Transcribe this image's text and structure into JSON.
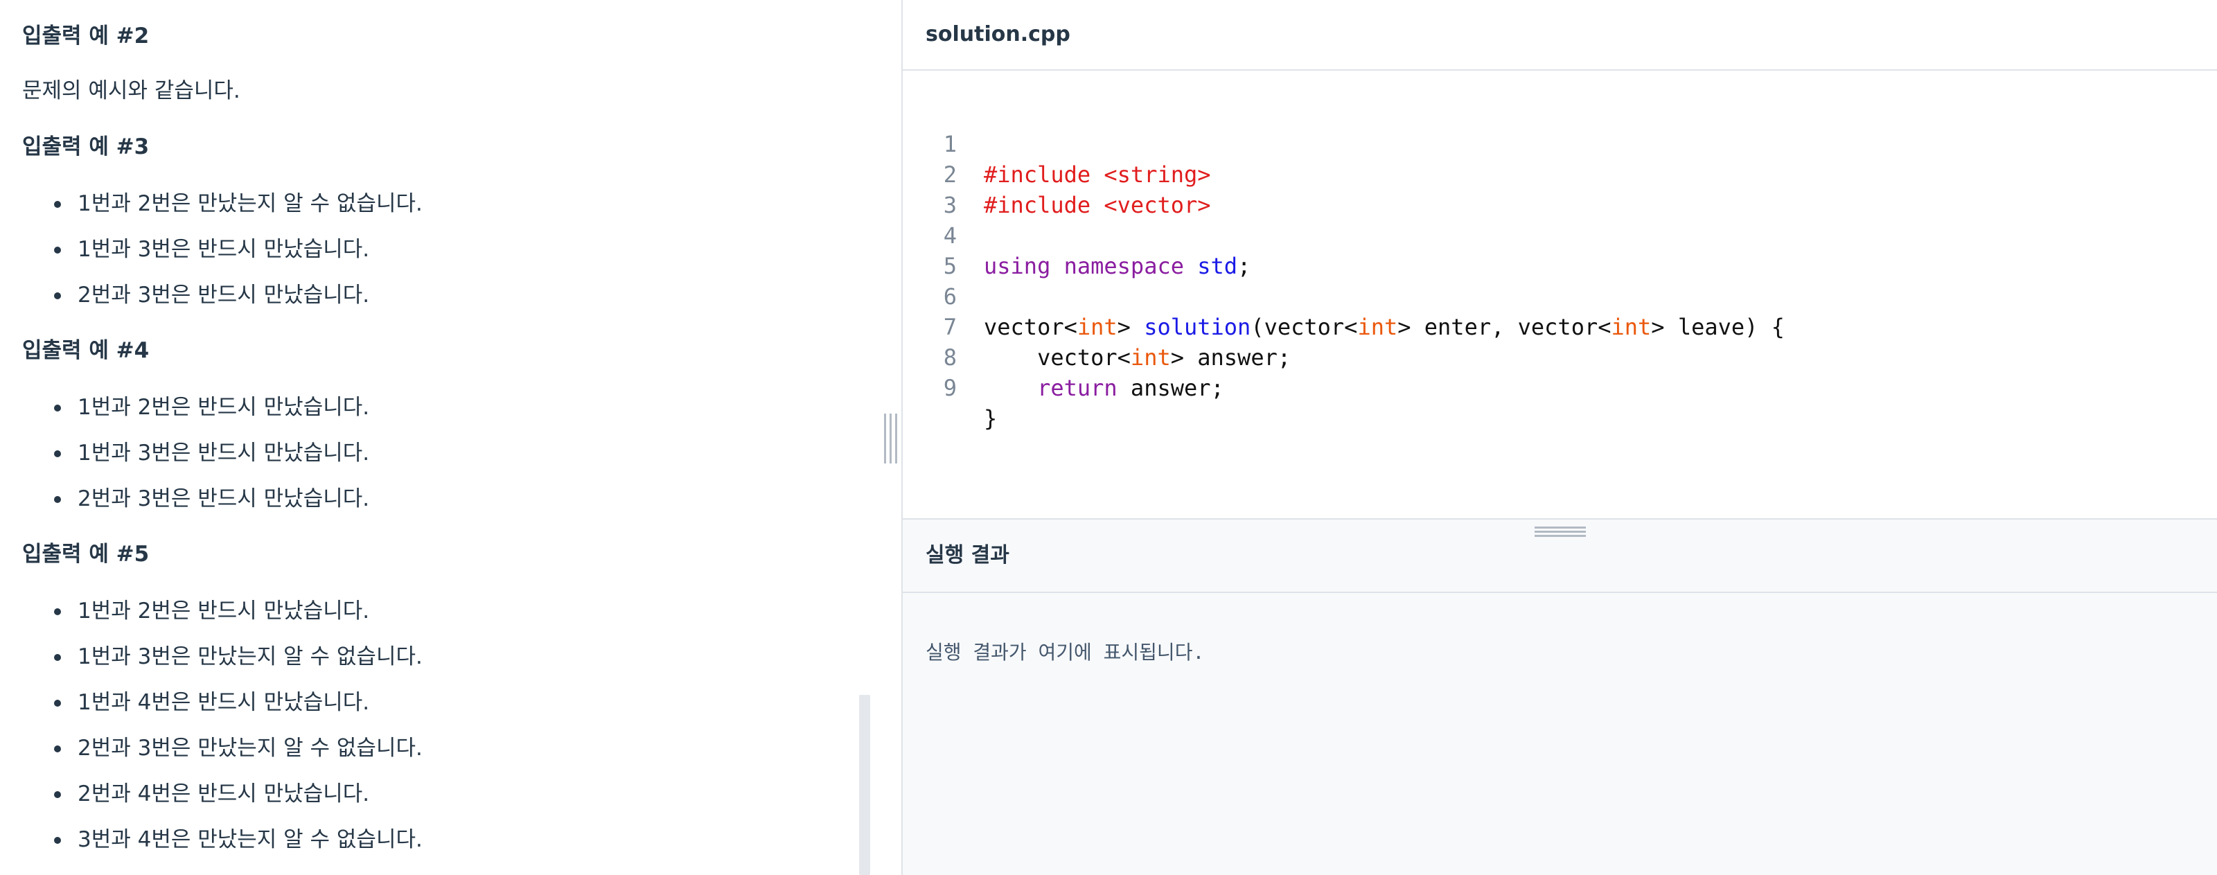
{
  "problem": {
    "sections": [
      {
        "heading": "입출력 예 #2",
        "paragraph": "문제의 예시와 같습니다.",
        "items": []
      },
      {
        "heading": "입출력 예 #3",
        "items": [
          "1번과 2번은 만났는지 알 수 없습니다.",
          "1번과 3번은 반드시 만났습니다.",
          "2번과 3번은 반드시 만났습니다."
        ]
      },
      {
        "heading": "입출력 예 #4",
        "items": [
          "1번과 2번은 반드시 만났습니다.",
          "1번과 3번은 반드시 만났습니다.",
          "2번과 3번은 반드시 만났습니다."
        ]
      },
      {
        "heading": "입출력 예 #5",
        "items": [
          "1번과 2번은 반드시 만났습니다.",
          "1번과 3번은 만났는지 알 수 없습니다.",
          "1번과 4번은 반드시 만났습니다.",
          "2번과 3번은 만났는지 알 수 없습니다.",
          "2번과 4번은 반드시 만났습니다.",
          "3번과 4번은 만났는지 알 수 없습니다."
        ]
      }
    ]
  },
  "editor": {
    "filename": "solution.cpp",
    "line_numbers": [
      "1",
      "2",
      "3",
      "4",
      "5",
      "6",
      "7",
      "8",
      "9"
    ],
    "lines": {
      "l1": {
        "a": "#include <string>"
      },
      "l2": {
        "a": "#include <vector>"
      },
      "l4": {
        "a": "using",
        "b": " ",
        "c": "namespace",
        "d": " ",
        "e": "std",
        "f": ";"
      },
      "l6": {
        "a": "vector<",
        "b": "int",
        "c": "> ",
        "d": "solution",
        "e": "(vector<",
        "f": "int",
        "g": "> enter, vector<",
        "h": "int",
        "i": "> leave) {"
      },
      "l7": {
        "a": "    vector<",
        "b": "int",
        "c": "> answer;"
      },
      "l8": {
        "a": "    ",
        "b": "return",
        "c": " answer;"
      },
      "l9": {
        "a": "}"
      }
    }
  },
  "result": {
    "title": "실행 결과",
    "placeholder": "실행 결과가 여기에 표시됩니다."
  }
}
